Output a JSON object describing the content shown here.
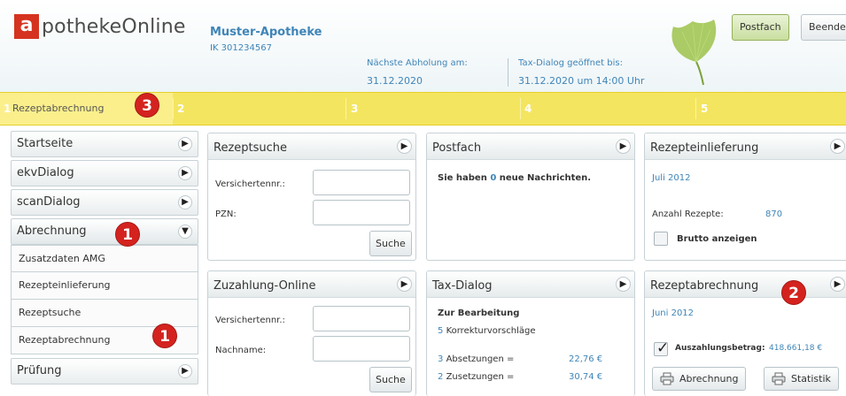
{
  "header": {
    "logo_letter": "a",
    "logo_text": "potheke",
    "logo_suffix": "Online",
    "pharmacy_name": "Muster-Apotheke",
    "pharmacy_ik": "IK 301234567",
    "pickup_label": "Nächste Abholung am:",
    "pickup_date": "31.12.2020",
    "taxdialog_label": "Tax-Dialog geöffnet bis:",
    "taxdialog_date": "31.12.2020 um 14:00 Uhr",
    "postfach_button": "Postfach",
    "beenden_button": "Beenden"
  },
  "steps": [
    {
      "num": "1",
      "label": "Rezeptabrechnung"
    },
    {
      "num": "2",
      "label": ""
    },
    {
      "num": "3",
      "label": ""
    },
    {
      "num": "4",
      "label": ""
    },
    {
      "num": "5",
      "label": ""
    }
  ],
  "badges": {
    "step": "3",
    "nav": "1",
    "nav_sub": "1",
    "panel": "2"
  },
  "nav": {
    "startseite": "Startseite",
    "ekvdialog": "ekvDialog",
    "scandialog": "scanDialog",
    "abrechnung": "Abrechnung",
    "sub": [
      "Zusatzdaten AMG",
      "Rezepteinlieferung",
      "Rezeptsuche",
      "Rezeptabrechnung"
    ],
    "pruefung": "Prüfung"
  },
  "rezeptsuche": {
    "title": "Rezeptsuche",
    "versichertennr_label": "Versichertennr.:",
    "pzn_label": "PZN:",
    "search_button": "Suche"
  },
  "postfach": {
    "title": "Postfach",
    "msg_prefix": "Sie haben",
    "msg_count": "0",
    "msg_suffix": "neue Nachrichten."
  },
  "rezepteinlieferung": {
    "title": "Rezepteinlieferung",
    "month": "Juli 2012",
    "count_label": "Anzahl Rezepte:",
    "count_value": "870",
    "brutto_label": "Brutto anzeigen",
    "brutto_checked": false
  },
  "zuzahlung": {
    "title": "Zuzahlung-Online",
    "versichertennr_label": "Versichertennr.:",
    "nachname_label": "Nachname:",
    "search_button": "Suche"
  },
  "taxdialog": {
    "title": "Tax-Dialog",
    "heading": "Zur Bearbeitung",
    "korrektur_count": "5",
    "korrektur_label": "Korrekturvorschläge",
    "absetzungen_count": "3",
    "absetzungen_label": "Absetzungen =",
    "absetzungen_value": "22,76 €",
    "zusetzungen_count": "2",
    "zusetzungen_label": "Zusetzungen =",
    "zusetzungen_value": "30,74 €"
  },
  "rezeptabrechnung": {
    "title": "Rezeptabrechnung",
    "month": "Juni 2012",
    "auszahlung_label": "Auszahlungsbetrag:",
    "auszahlung_value": "418.661,18 €",
    "auszahlung_checked": true,
    "abrechnung_button": "Abrechnung",
    "statistik_button": "Statistik"
  },
  "colors": {
    "accent_blue": "#3f85b8",
    "logo_red": "#d5331f",
    "step_yellow": "#f4e560",
    "badge_red": "#d4231f"
  }
}
